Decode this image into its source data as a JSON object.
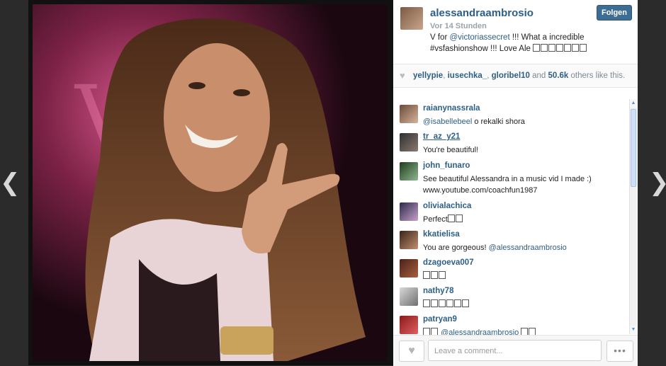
{
  "navigation": {
    "prev_icon": "chevron-left-icon",
    "next_icon": "chevron-right-icon",
    "prev_glyph": "❮",
    "next_glyph": "❯"
  },
  "post": {
    "owner_username": "alessandraambrosio",
    "follow_label": "Folgen",
    "time_ago": "Vor 14 Stunden",
    "caption_prefix": "V for ",
    "caption_mention": "@victoriassecret",
    "caption_rest": " !!! What a incredible #vsfashionshow !!! Love Ale "
  },
  "likes": {
    "heart_icon": "heart-icon",
    "users": [
      "yellypie",
      "iusechka_",
      "gloribel10"
    ],
    "and_word": "and",
    "others_count": "50.6k",
    "others_suffix": "others like this."
  },
  "comments": [
    {
      "username": "raianynassrala",
      "mention": "@isabellebeel",
      "text": " o rekalki shora"
    },
    {
      "username": "tr_az_y21",
      "text": "You're beautiful!"
    },
    {
      "username": "john_funaro",
      "text": "See beautiful Alessandra in a music vid I made :) www.youtube.com/coachfun1987"
    },
    {
      "username": "olivialachica",
      "text": "Perfect"
    },
    {
      "username": "kkatielisa",
      "text": "You are gorgeous! ",
      "mention": "@alessandraambrosio"
    },
    {
      "username": "dzagoeva007",
      "text": ""
    },
    {
      "username": "nathy78",
      "text": ""
    },
    {
      "username": "patryan9",
      "text": "",
      "mention": "@alessandraambrosio"
    }
  ],
  "footer": {
    "comment_placeholder": "Leave a comment...",
    "like_glyph": "♥",
    "more_glyph": "•••"
  },
  "colors": {
    "link": "#2d5f86",
    "follow_button": "#3e6d93",
    "background": "#2b2b2b"
  }
}
